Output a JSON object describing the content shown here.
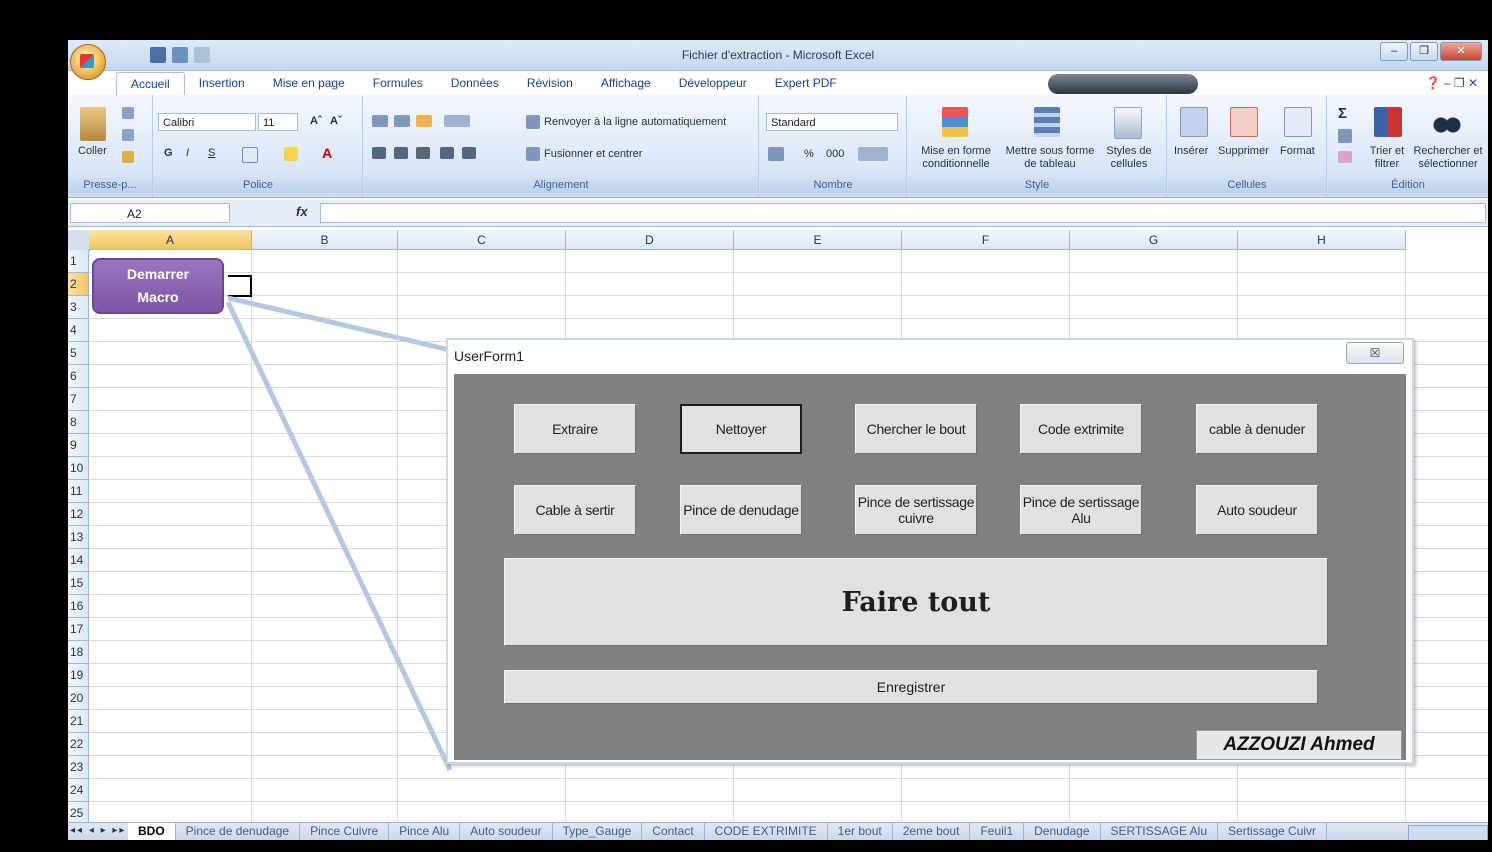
{
  "window": {
    "title": "Fichier d'extraction - Microsoft Excel",
    "controls": [
      "–",
      "❐",
      "✕"
    ]
  },
  "tabs": [
    "Accueil",
    "Insertion",
    "Mise en page",
    "Formules",
    "Données",
    "Révision",
    "Affichage",
    "Développeur",
    "Expert PDF"
  ],
  "active_tab": "Accueil",
  "ribbon": {
    "clipboard": {
      "paste": "Coller",
      "label": "Presse-p..."
    },
    "font": {
      "name": "Calibri",
      "size": "11",
      "grow": "Aˆ",
      "shrink": "Aˇ",
      "bold": "G",
      "italic": "I",
      "underline": "S",
      "color": "A",
      "label": "Police"
    },
    "alignment": {
      "wrap": "Renvoyer à la ligne automatiquement",
      "merge": "Fusionner et centrer",
      "label": "Alignement"
    },
    "number": {
      "format": "Standard",
      "percent": "%",
      "thousands": "000",
      "label": "Nombre"
    },
    "style": {
      "conditional": "Mise en forme conditionnelle",
      "table": "Mettre sous forme de tableau",
      "cell_styles": "Styles de cellules",
      "label": "Style"
    },
    "cells": {
      "insert": "Insérer",
      "delete": "Supprimer",
      "format": "Format",
      "label": "Cellules"
    },
    "editing": {
      "sigma": "Σ",
      "sort": "Trier et filtrer",
      "find": "Rechercher et sélectionner",
      "label": "Édition"
    }
  },
  "formula_bar": {
    "name_box": "A2",
    "fx": "fx",
    "value": ""
  },
  "columns": [
    "A",
    "B",
    "C",
    "D",
    "E",
    "F",
    "G",
    "H"
  ],
  "rows": [
    "1",
    "2",
    "3",
    "4",
    "5",
    "6",
    "7",
    "8",
    "9",
    "10",
    "11",
    "12",
    "13",
    "14",
    "15",
    "16",
    "17",
    "18",
    "19",
    "20",
    "21",
    "22",
    "23",
    "24",
    "25"
  ],
  "selected_cell": "A2",
  "macro_button": {
    "line1": "Demarrer",
    "line2": "Macro"
  },
  "userform": {
    "title": "UserForm1",
    "close": "☒",
    "row1": [
      "Extraire",
      "Nettoyer",
      "Chercher le bout",
      "Code extrimite",
      "cable à denuder"
    ],
    "row2": [
      "Cable à sertir",
      "Pince de denudage",
      "Pince de sertissage cuivre",
      "Pince de sertissage Alu",
      "Auto soudeur"
    ],
    "main_button": "Faire tout",
    "save_button": "Enregistrer",
    "author": "AZZOUZI  Ahmed"
  },
  "sheet_tabs": [
    "BDO",
    "Pince de denudage",
    "Pince Cuivre",
    "Pince Alu",
    "Auto soudeur",
    "Type_Gauge",
    "Contact",
    "CODE EXTRIMITE",
    "1er bout",
    "2eme bout",
    "Feuil1",
    "Denudage",
    "SERTISSAGE Alu",
    "Sertissage Cuivr"
  ],
  "active_sheet": "BDO",
  "colors": {
    "macro_button": "#8a64b3",
    "form_body": "#808080",
    "ribbon": "#dbe7f6"
  }
}
